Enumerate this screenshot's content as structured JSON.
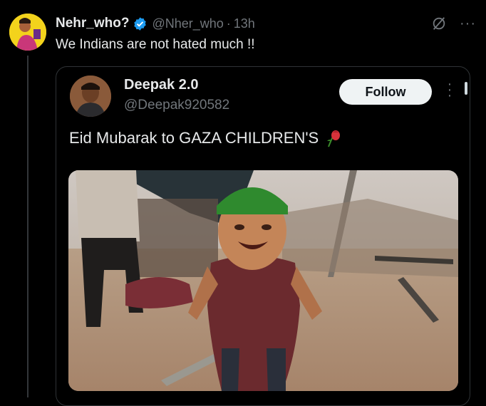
{
  "tweet": {
    "author_name": "Nehr_who?",
    "handle": "@Nher_who",
    "separator": "·",
    "time": "13h",
    "text": "We Indians are not hated much !!",
    "more_icon": "more-horizontal-icon",
    "grok_icon": "grok-icon"
  },
  "quoted": {
    "author_name": "Deepak 2.0",
    "handle": "@Deepak920582",
    "follow_label": "Follow",
    "text": "Eid Mubarak to GAZA CHILDREN'S",
    "emoji_icon": "wilted-rose-icon",
    "image_subject": "photo"
  },
  "colors": {
    "background": "#000000",
    "text_primary": "#e7e9ea",
    "text_secondary": "#71767b",
    "verified_blue": "#1d9bf0",
    "follow_bg": "#eff3f4",
    "border": "#2f3336"
  }
}
